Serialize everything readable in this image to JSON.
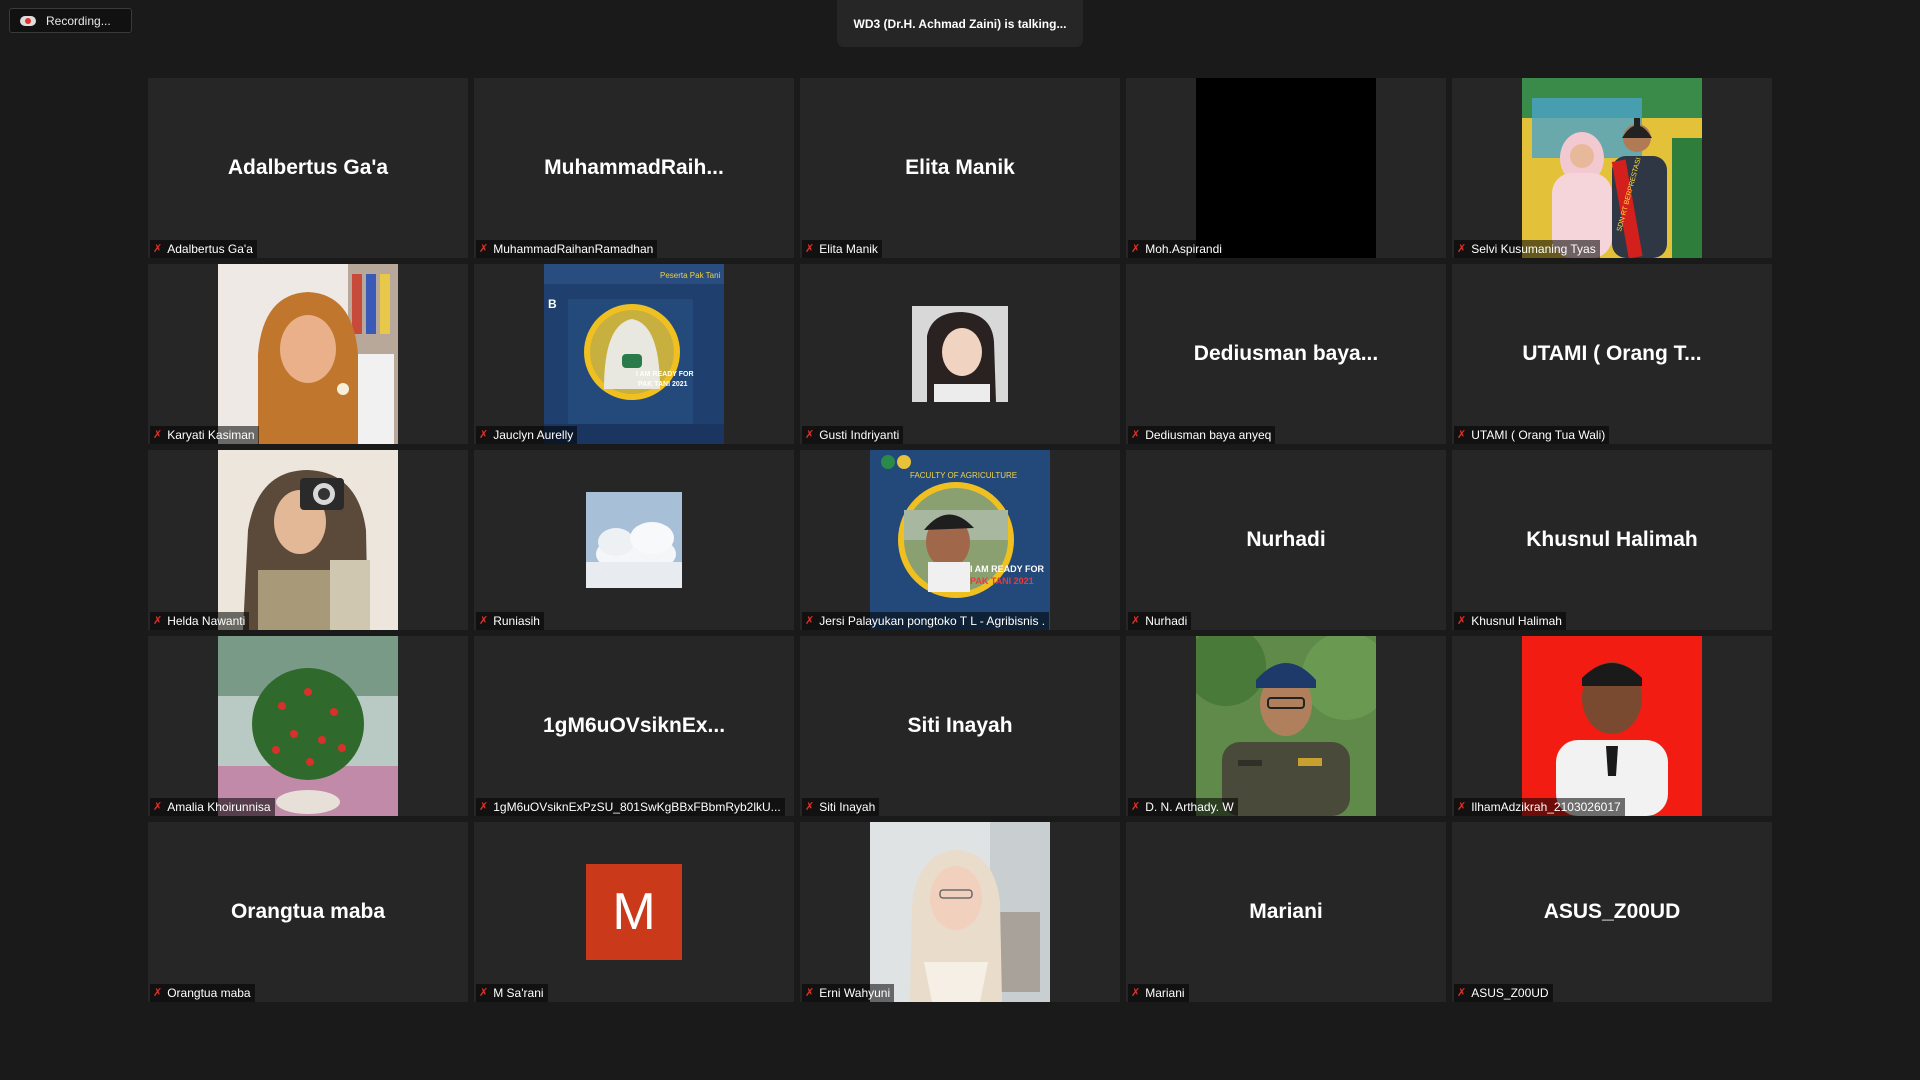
{
  "recording": {
    "label": "Recording..."
  },
  "talking": {
    "text": "WD3 (Dr.H. Achmad Zaini) is talking..."
  },
  "participants": [
    {
      "display": "Adalbertus Ga'a",
      "tag": "Adalbertus Ga'a"
    },
    {
      "display": "MuhammadRaih...",
      "tag": "MuhammadRaihanRamadhan"
    },
    {
      "display": "Elita Manik",
      "tag": "Elita Manik"
    },
    {
      "display": "",
      "tag": "Moh.Aspirandi"
    },
    {
      "display": "",
      "tag": "Selvi Kusumaning Tyas"
    },
    {
      "display": "",
      "tag": "Karyati Kasiman"
    },
    {
      "display": "",
      "tag": "Jauclyn Aurelly"
    },
    {
      "display": "",
      "tag": "Gusti Indriyanti"
    },
    {
      "display": "Dediusman  baya...",
      "tag": "Dediusman baya anyeq"
    },
    {
      "display": "UTAMI ( Orang T...",
      "tag": "UTAMI ( Orang Tua Wali)"
    },
    {
      "display": "",
      "tag": "Helda Nawanti"
    },
    {
      "display": "",
      "tag": "Runiasih"
    },
    {
      "display": "",
      "tag": "Jersi Palayukan pongtoko T L - Agribisnis ."
    },
    {
      "display": "Nurhadi",
      "tag": "Nurhadi"
    },
    {
      "display": "Khusnul Halimah",
      "tag": "Khusnul Halimah"
    },
    {
      "display": "",
      "tag": "Amalia Khoirunnisa"
    },
    {
      "display": "1gM6uOVsiknEx...",
      "tag": "1gM6uOVsiknExPzSU_801SwKgBBxFBbmRyb2lkU..."
    },
    {
      "display": "Siti Inayah",
      "tag": "Siti Inayah"
    },
    {
      "display": "",
      "tag": "D. N. Arthady. W"
    },
    {
      "display": "",
      "tag": "IlhamAdzikrah_2103026017"
    },
    {
      "display": "Orangtua maba",
      "tag": "Orangtua maba"
    },
    {
      "display": "M",
      "tag": "M Sa'rani"
    },
    {
      "display": "",
      "tag": "Erni Wahyuni"
    },
    {
      "display": "Mariani",
      "tag": "Mariani"
    },
    {
      "display": "ASUS_Z00UD",
      "tag": "ASUS_Z00UD"
    }
  ],
  "banners": {
    "jauclyn_line1": "Peserta Pak Tani",
    "jauclyn_line2": "I AM READY FOR",
    "jauclyn_line3": "PAK TANI 2021",
    "jersi_line1": "FACULTY OF AGRICULTURE",
    "jersi_line2": "I AM READY FOR",
    "jersi_line3": "PAK TANI 2021",
    "selvi_sash": "SDN RT BERPRESTASI"
  },
  "colors": {
    "tile_bg": "#262626",
    "page_bg": "#1a1a1a",
    "mic_muted": "#e0312b",
    "m_avatar": "#c9391a"
  }
}
